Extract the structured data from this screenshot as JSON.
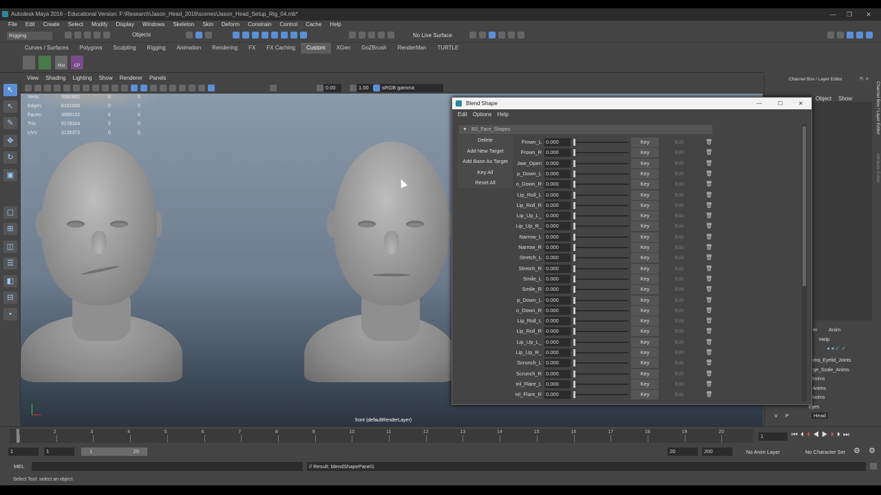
{
  "window": {
    "title": "Autodesk Maya 2016 - Educational Version: F:\\Research\\Jason_Head_2016\\scenes\\Jason_Head_Setup_Rig_04.mb*"
  },
  "menubar": [
    "File",
    "Edit",
    "Create",
    "Select",
    "Modify",
    "Display",
    "Windows",
    "Skeleton",
    "Skin",
    "Deform",
    "Constrain",
    "Control",
    "Cache",
    "Help"
  ],
  "statusline": {
    "mode": "Rigging",
    "selection_mode": "Objects",
    "live_surface": "No Live Surface"
  },
  "shelf_tabs": [
    "Curves / Surfaces",
    "Polygons",
    "Sculpting",
    "Rigging",
    "Animation",
    "Rendering",
    "FX",
    "FX Caching",
    "Custom",
    "XGen",
    "GoZBrush",
    "RenderMan",
    "TURTLE"
  ],
  "shelf_active": "Custom",
  "shelf_icons": [
    {
      "label": ""
    },
    {
      "label": ""
    },
    {
      "label": "Hist"
    },
    {
      "label": "CP"
    }
  ],
  "viewport": {
    "menu": [
      "View",
      "Shading",
      "Lighting",
      "Show",
      "Renderer",
      "Panels"
    ],
    "exposure": "0.00",
    "gamma": "1.00",
    "color_space": "sRGB gamma",
    "camera_label": "front (defaultRenderLayer)",
    "hud": [
      {
        "name": "Verts:",
        "v1": "3092892",
        "v2": "0",
        "v3": "0"
      },
      {
        "name": "Edges:",
        "v1": "6182000",
        "v2": "0",
        "v3": "0"
      },
      {
        "name": "Faces:",
        "v1": "3089152",
        "v2": "0",
        "v3": "0"
      },
      {
        "name": "Tris:",
        "v1": "6178304",
        "v2": "0",
        "v3": "0"
      },
      {
        "name": "UVs:",
        "v1": "3135372",
        "v2": "0",
        "v3": "0"
      }
    ]
  },
  "channel_box": {
    "title": "Channel Box / Layer Editor",
    "menu": [
      "Object",
      "Show"
    ],
    "layer_tabs": [
      "er",
      "Anim"
    ],
    "layer_help": "Help",
    "layers": [
      "Extra_Eyelid_Joints",
      "arge_Scale_Anims",
      "_Anims",
      "l_Anims",
      "_Anims",
      "Eyes"
    ],
    "layer_footer": {
      "v": "V",
      "p": "P",
      "name": "Head"
    },
    "side_tabs": [
      "Channel Box / Layer Editor",
      "Attribute Editor"
    ]
  },
  "blend_shape": {
    "title": "Blend Shape",
    "menu": [
      "Edit",
      "Options",
      "Help"
    ],
    "node": "BS_Face_Shapes",
    "buttons": [
      "Delete",
      "Add New Target",
      "Add Base As Target",
      "Key All",
      "Reset All"
    ],
    "key_label": "Key",
    "edit_label": "Edit",
    "targets": [
      {
        "name": "Frown_L",
        "value": "0.000"
      },
      {
        "name": "Frown_R",
        "value": "0.000"
      },
      {
        "name": "Jaw_Open",
        "value": "0.000"
      },
      {
        "name": "p_Down_L",
        "value": "0.000"
      },
      {
        "name": "o_Down_R",
        "value": "0.000"
      },
      {
        "name": "Lip_Roll_L",
        "value": "0.000"
      },
      {
        "name": "Lip_Roll_R",
        "value": "0.000"
      },
      {
        "name": "_Lip_Up_L",
        "value": "0.000"
      },
      {
        "name": "_Lip_Up_R",
        "value": "0.000"
      },
      {
        "name": "Narrow_L",
        "value": "0.000"
      },
      {
        "name": "Narrow_R",
        "value": "0.000"
      },
      {
        "name": "Stretch_L",
        "value": "0.000"
      },
      {
        "name": "Stretch_R",
        "value": "0.000"
      },
      {
        "name": "Smile_L",
        "value": "0.000"
      },
      {
        "name": "Smile_R",
        "value": "0.000"
      },
      {
        "name": "p_Down_L",
        "value": "0.000"
      },
      {
        "name": "o_Down_R",
        "value": "0.000"
      },
      {
        "name": "Lip_Roll_L",
        "value": "0.000"
      },
      {
        "name": "Lip_Roll_R",
        "value": "0.000"
      },
      {
        "name": "_Lip_Up_L",
        "value": "0.000"
      },
      {
        "name": "_Lip_Up_R",
        "value": "0.000"
      },
      {
        "name": "Scrunch_L",
        "value": "0.000"
      },
      {
        "name": "Scrunch_R",
        "value": "0.000"
      },
      {
        "name": "tril_Flare_L",
        "value": "0.000"
      },
      {
        "name": "nil_Flare_R",
        "value": "0.000"
      }
    ]
  },
  "timeline": {
    "ticks": [
      "1",
      "2",
      "3",
      "4",
      "5",
      "6",
      "7",
      "8",
      "9",
      "10",
      "11",
      "12",
      "13",
      "14",
      "15",
      "16",
      "17",
      "18",
      "19",
      "20"
    ],
    "current_frame": "1"
  },
  "range": {
    "start": "1",
    "inner_start": "1",
    "slider_start": "1",
    "slider_end": "20",
    "inner_end": "20",
    "end": "200",
    "anim_layer": "No Anim Layer",
    "character_set": "No Character Set"
  },
  "command": {
    "lang": "MEL",
    "result": "// Result: blendShapePanel1"
  },
  "help_line": "Select Tool: select an object",
  "colors": {
    "accent_blue": "#5b8fd6",
    "viewport_top": "#8a9aab",
    "viewport_bottom": "#2c3540"
  }
}
